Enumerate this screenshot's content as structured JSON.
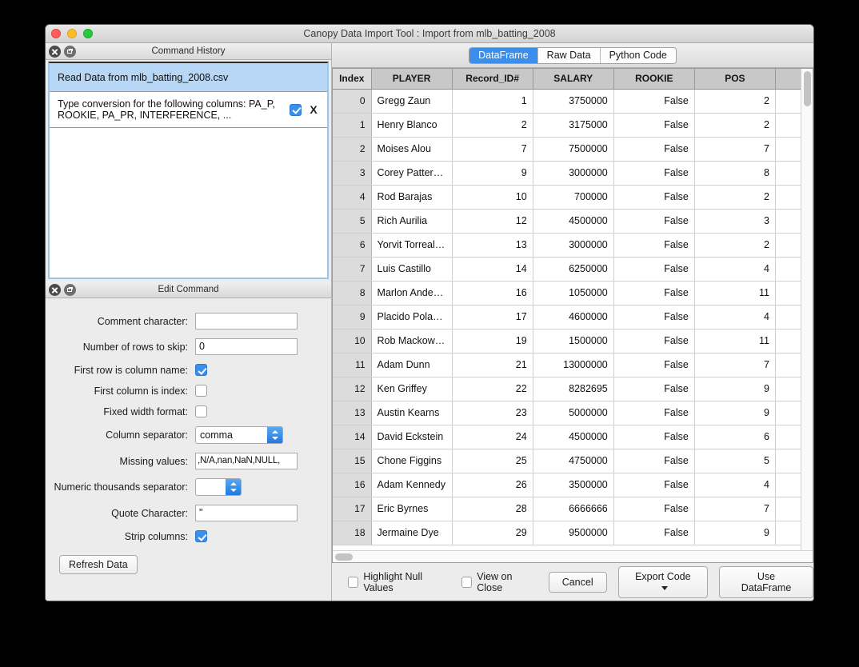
{
  "window": {
    "title": "Canopy Data Import Tool : Import from mlb_batting_2008"
  },
  "command_history": {
    "panel_title": "Command History",
    "close_icon": "close-icon",
    "float_icon": "float-window-icon",
    "items": [
      {
        "text": "Read Data from mlb_batting_2008.csv",
        "selected": true,
        "has_controls": false
      },
      {
        "text": "Type conversion for the following columns: PA_P, ROOKIE, PA_PR, INTERFERENCE, ...",
        "selected": false,
        "has_controls": true,
        "checked": true,
        "remove_label": "X"
      }
    ]
  },
  "edit_command": {
    "panel_title": "Edit Command",
    "fields": {
      "comment_character": {
        "label": "Comment character:",
        "value": ""
      },
      "rows_to_skip": {
        "label": "Number of rows to skip:",
        "value": "0"
      },
      "first_row_column_name": {
        "label": "First row is column name:",
        "checked": true
      },
      "first_column_index": {
        "label": "First column is index:",
        "checked": false
      },
      "fixed_width_format": {
        "label": "Fixed width format:",
        "checked": false
      },
      "column_separator": {
        "label": "Column separator:",
        "value": "comma"
      },
      "missing_values": {
        "label": "Missing values:",
        "value": ",N/A,nan,NaN,NULL,"
      },
      "thousands_separator": {
        "label": "Numeric thousands separator:",
        "value": ""
      },
      "quote_character": {
        "label": "Quote Character:",
        "value": "\""
      },
      "strip_columns": {
        "label": "Strip columns:",
        "checked": true
      }
    },
    "refresh_button": "Refresh Data"
  },
  "tabs": [
    {
      "label": "DataFrame",
      "active": true
    },
    {
      "label": "Raw Data",
      "active": false
    },
    {
      "label": "Python Code",
      "active": false
    }
  ],
  "table": {
    "columns": [
      "Index",
      "PLAYER",
      "Record_ID#",
      "SALARY",
      "ROOKIE",
      "POS",
      ""
    ],
    "rows": [
      [
        "0",
        "Gregg Zaun",
        "1",
        "3750000",
        "False",
        "2",
        ""
      ],
      [
        "1",
        "Henry Blanco",
        "2",
        "3175000",
        "False",
        "2",
        ""
      ],
      [
        "2",
        "Moises Alou",
        "7",
        "7500000",
        "False",
        "7",
        ""
      ],
      [
        "3",
        "Corey Patter…",
        "9",
        "3000000",
        "False",
        "8",
        ""
      ],
      [
        "4",
        "Rod Barajas",
        "10",
        "700000",
        "False",
        "2",
        ""
      ],
      [
        "5",
        "Rich Aurilia",
        "12",
        "4500000",
        "False",
        "3",
        ""
      ],
      [
        "6",
        "Yorvit Torreal…",
        "13",
        "3000000",
        "False",
        "2",
        ""
      ],
      [
        "7",
        "Luis Castillo",
        "14",
        "6250000",
        "False",
        "4",
        ""
      ],
      [
        "8",
        "Marlon Ande…",
        "16",
        "1050000",
        "False",
        "11",
        ""
      ],
      [
        "9",
        "Placido Pola…",
        "17",
        "4600000",
        "False",
        "4",
        ""
      ],
      [
        "10",
        "Rob Mackow…",
        "19",
        "1500000",
        "False",
        "11",
        ""
      ],
      [
        "11",
        "Adam Dunn",
        "21",
        "13000000",
        "False",
        "7",
        ""
      ],
      [
        "12",
        "Ken Griffey",
        "22",
        "8282695",
        "False",
        "9",
        ""
      ],
      [
        "13",
        "Austin Kearns",
        "23",
        "5000000",
        "False",
        "9",
        ""
      ],
      [
        "14",
        "David Eckstein",
        "24",
        "4500000",
        "False",
        "6",
        ""
      ],
      [
        "15",
        "Chone Figgins",
        "25",
        "4750000",
        "False",
        "5",
        ""
      ],
      [
        "16",
        "Adam Kennedy",
        "26",
        "3500000",
        "False",
        "4",
        ""
      ],
      [
        "17",
        "Eric Byrnes",
        "28",
        "6666666",
        "False",
        "7",
        ""
      ],
      [
        "18",
        "Jermaine Dye",
        "29",
        "9500000",
        "False",
        "9",
        ""
      ]
    ]
  },
  "bottom_bar": {
    "highlight_null": {
      "label": "Highlight Null Values",
      "checked": false
    },
    "view_on_close": {
      "label": "View on Close",
      "checked": false
    },
    "cancel": "Cancel",
    "export_code": "Export Code",
    "use_dataframe": "Use DataFrame"
  },
  "colors": {
    "accent": "#3b8eea",
    "selection": "#b8d6f5",
    "header": "#c8c8c8",
    "window_bg": "#ececec"
  }
}
